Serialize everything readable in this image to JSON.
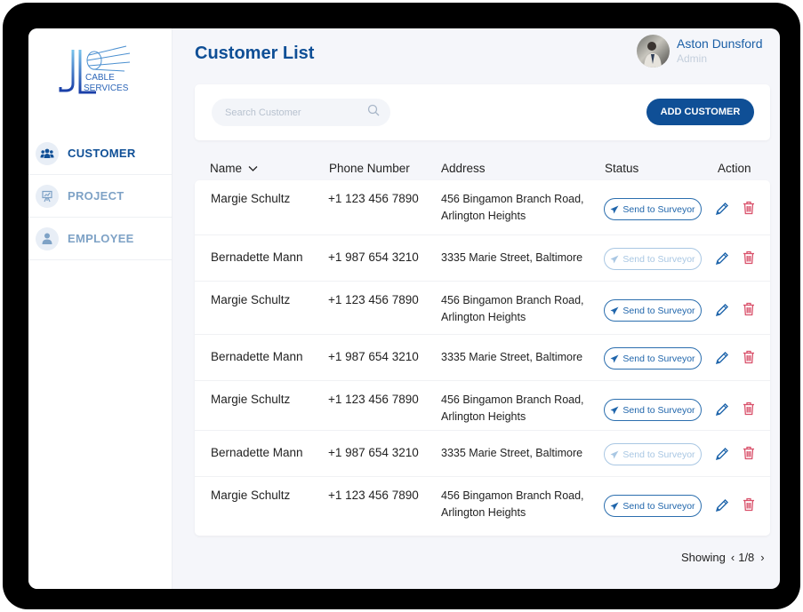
{
  "app": {
    "logo": {
      "line1": "CABLE",
      "line2": "SERVICES",
      "monogram": "JL"
    },
    "page_title": "Customer List"
  },
  "sidebar": {
    "items": [
      {
        "label": "CUSTOMER",
        "icon": "users-icon",
        "active": true
      },
      {
        "label": "PROJECT",
        "icon": "presentation-icon",
        "active": false
      },
      {
        "label": "EMPLOYEE",
        "icon": "user-icon",
        "active": false
      }
    ]
  },
  "user": {
    "name": "Aston Dunsford",
    "role": "Admin"
  },
  "toolbar": {
    "search_placeholder": "Search Customer",
    "search_value": "",
    "add_label": "ADD CUSTOMER"
  },
  "table": {
    "columns": {
      "name": "Name",
      "phone": "Phone Number",
      "address": "Address",
      "status": "Status",
      "action": "Action"
    },
    "rows": [
      {
        "name": "Margie Schultz",
        "phone": "+1 123 456 7890",
        "address1": "456  Bingamon Branch Road,",
        "address2": "Arlington Heights",
        "status": "Send to Surveyor",
        "status_enabled": true
      },
      {
        "name": "Bernadette Mann",
        "phone": "+1 987 654 3210",
        "address1": "3335  Marie Street, Baltimore",
        "address2": "",
        "status": "Send to Surveyor",
        "status_enabled": false
      },
      {
        "name": "Margie Schultz",
        "phone": "+1 123 456 7890",
        "address1": "456  Bingamon Branch Road,",
        "address2": "Arlington Heights",
        "status": "Send to Surveyor",
        "status_enabled": true
      },
      {
        "name": "Bernadette Mann",
        "phone": "+1 987 654 3210",
        "address1": "3335  Marie Street, Baltimore",
        "address2": "",
        "status": "Send to Surveyor",
        "status_enabled": true
      },
      {
        "name": "Margie Schultz",
        "phone": "+1 123 456 7890",
        "address1": "456  Bingamon Branch Road,",
        "address2": "Arlington Heights",
        "status": "Send to Surveyor",
        "status_enabled": true
      },
      {
        "name": "Bernadette Mann",
        "phone": "+1 987 654 3210",
        "address1": "3335  Marie Street, Baltimore",
        "address2": "",
        "status": "Send to Surveyor",
        "status_enabled": false
      },
      {
        "name": "Margie Schultz",
        "phone": "+1 123 456 7890",
        "address1": "456  Bingamon Branch Road,",
        "address2": "Arlington Heights",
        "status": "Send to Surveyor",
        "status_enabled": true
      }
    ]
  },
  "pagination": {
    "label": "Showing",
    "current": "1/8",
    "prev": "‹",
    "next": "›"
  },
  "colors": {
    "primary": "#0f4f96",
    "muted": "#7ea2c6",
    "delete": "#d9506a",
    "status_disabled": "#a9c7e3"
  }
}
